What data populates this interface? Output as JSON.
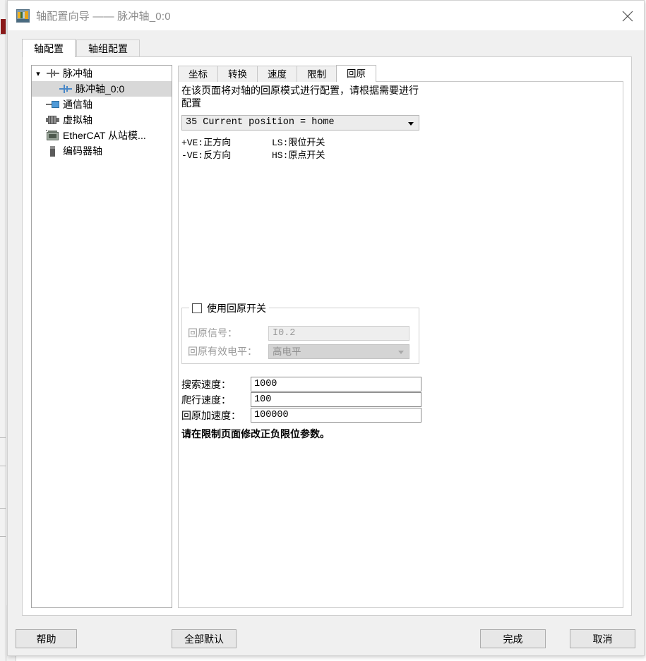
{
  "window": {
    "title": "轴配置向导 —— 脉冲轴_0:0",
    "icon": "plc-module-icon",
    "close_label": "✕"
  },
  "outer_tabs": [
    {
      "label": "轴配置",
      "active": true
    },
    {
      "label": "轴组配置",
      "active": false
    }
  ],
  "tree": {
    "nodes": [
      {
        "label": "脉冲轴",
        "icon": "pulse-wave-icon",
        "expanded": true,
        "selected": false,
        "indent": 0,
        "chevron": "▾"
      },
      {
        "label": "脉冲轴_0:0",
        "icon": "pulse-wave-icon",
        "expanded": false,
        "selected": true,
        "indent": 1,
        "chevron": ""
      },
      {
        "label": "通信轴",
        "icon": "communication-axis-icon",
        "expanded": false,
        "selected": false,
        "indent": 0,
        "chevron": ""
      },
      {
        "label": "虚拟轴",
        "icon": "virtual-axis-motor-icon",
        "expanded": false,
        "selected": false,
        "indent": 0,
        "chevron": ""
      },
      {
        "label": "EtherCAT 从站模...",
        "icon": "ethercat-slave-module-icon",
        "expanded": false,
        "selected": false,
        "indent": 0,
        "chevron": ""
      },
      {
        "label": "编码器轴",
        "icon": "encoder-axis-icon",
        "expanded": false,
        "selected": false,
        "indent": 0,
        "chevron": ""
      }
    ]
  },
  "inner_tabs": [
    {
      "label": "坐标",
      "active": false
    },
    {
      "label": "转换",
      "active": false
    },
    {
      "label": "速度",
      "active": false
    },
    {
      "label": "限制",
      "active": false
    },
    {
      "label": "回原",
      "active": true
    }
  ],
  "homing": {
    "description": "在该页面将对轴的回原模式进行配置，请根据需要进行配置",
    "mode_value": "35 Current position = home",
    "legend": {
      "r1c1": "+VE:正方向",
      "r1c2": "LS:限位开关",
      "r2c1": "-VE:反方向",
      "r2c2": "HS:原点开关"
    },
    "switch_group": {
      "checkbox_label": "使用回原开关",
      "checked": false,
      "signal_label": "回原信号：",
      "signal_value": "I0.2",
      "level_label": "回原有效电平：",
      "level_value": "高电平"
    },
    "fields": [
      {
        "label": "搜索速度：",
        "value": "1000"
      },
      {
        "label": "爬行速度：",
        "value": "100"
      },
      {
        "label": "回原加速度：",
        "value": "100000"
      }
    ],
    "note": "请在限制页面修改正负限位参数。"
  },
  "footer": {
    "help": "帮助",
    "defaults": "全部默认",
    "finish": "完成",
    "cancel": "取消"
  }
}
